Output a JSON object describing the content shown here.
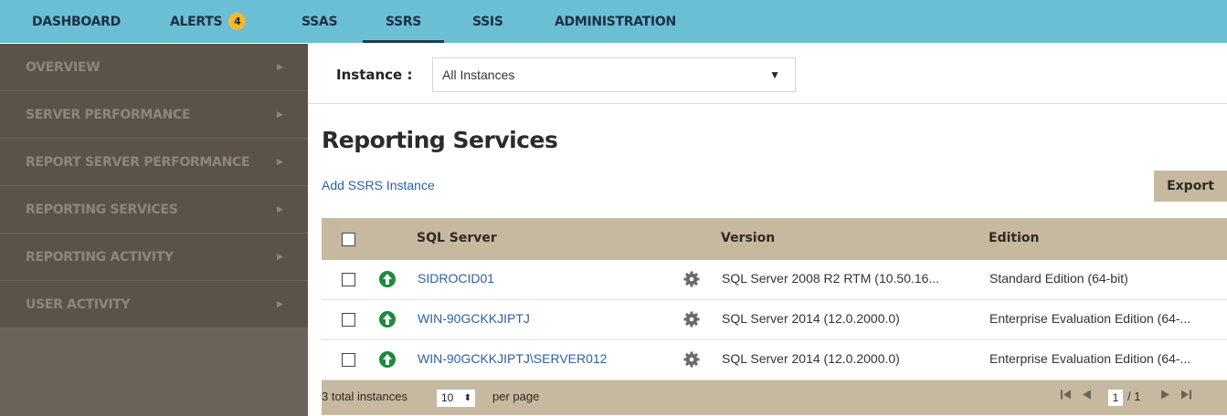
{
  "topnav": {
    "tabs": [
      {
        "label": "DASHBOARD"
      },
      {
        "label": "ALERTS",
        "badge": "4"
      },
      {
        "label": "SSAS"
      },
      {
        "label": "SSRS"
      },
      {
        "label": "SSIS"
      },
      {
        "label": "ADMINISTRATION"
      }
    ],
    "active_tab": "SSRS"
  },
  "sidebar": {
    "items": [
      {
        "label": "OVERVIEW"
      },
      {
        "label": "SERVER PERFORMANCE"
      },
      {
        "label": "REPORT SERVER PERFORMANCE"
      },
      {
        "label": "REPORTING SERVICES"
      },
      {
        "label": "REPORTING ACTIVITY"
      },
      {
        "label": "USER ACTIVITY"
      }
    ],
    "arrow": "▶"
  },
  "instance_filter": {
    "label": "Instance :",
    "selected": "All Instances"
  },
  "page": {
    "title": "Reporting Services",
    "add_link": "Add SSRS Instance",
    "export_label": "Export"
  },
  "grid": {
    "columns": [
      "SQL Server",
      "Version",
      "Edition"
    ],
    "rows": [
      {
        "server": "SIDROCID01",
        "version": "SQL Server 2008 R2 RTM (10.50.16...",
        "edition": "Standard Edition (64-bit)",
        "status": "up"
      },
      {
        "server": "WIN-90GCKKJIPTJ",
        "version": "SQL Server 2014 (12.0.2000.0)",
        "edition": "Enterprise Evaluation Edition (64-...",
        "status": "up"
      },
      {
        "server": "WIN-90GCKKJIPTJ\\SERVER012",
        "version": "SQL Server 2014 (12.0.2000.0)",
        "edition": "Enterprise Evaluation Edition (64-...",
        "status": "up"
      }
    ],
    "footer": {
      "total_text": "3 total instances",
      "page_size": "10",
      "per_page_text": "per page",
      "current_page": "1",
      "total_pages_text": "/ 1"
    }
  },
  "colors": {
    "topnav_bg": "#6bbfd4",
    "sidebar_bg": "#5b5347",
    "grid_header_bg": "#c6b9a0",
    "status_up": "#1d8a3e",
    "link": "#2b62a0"
  }
}
